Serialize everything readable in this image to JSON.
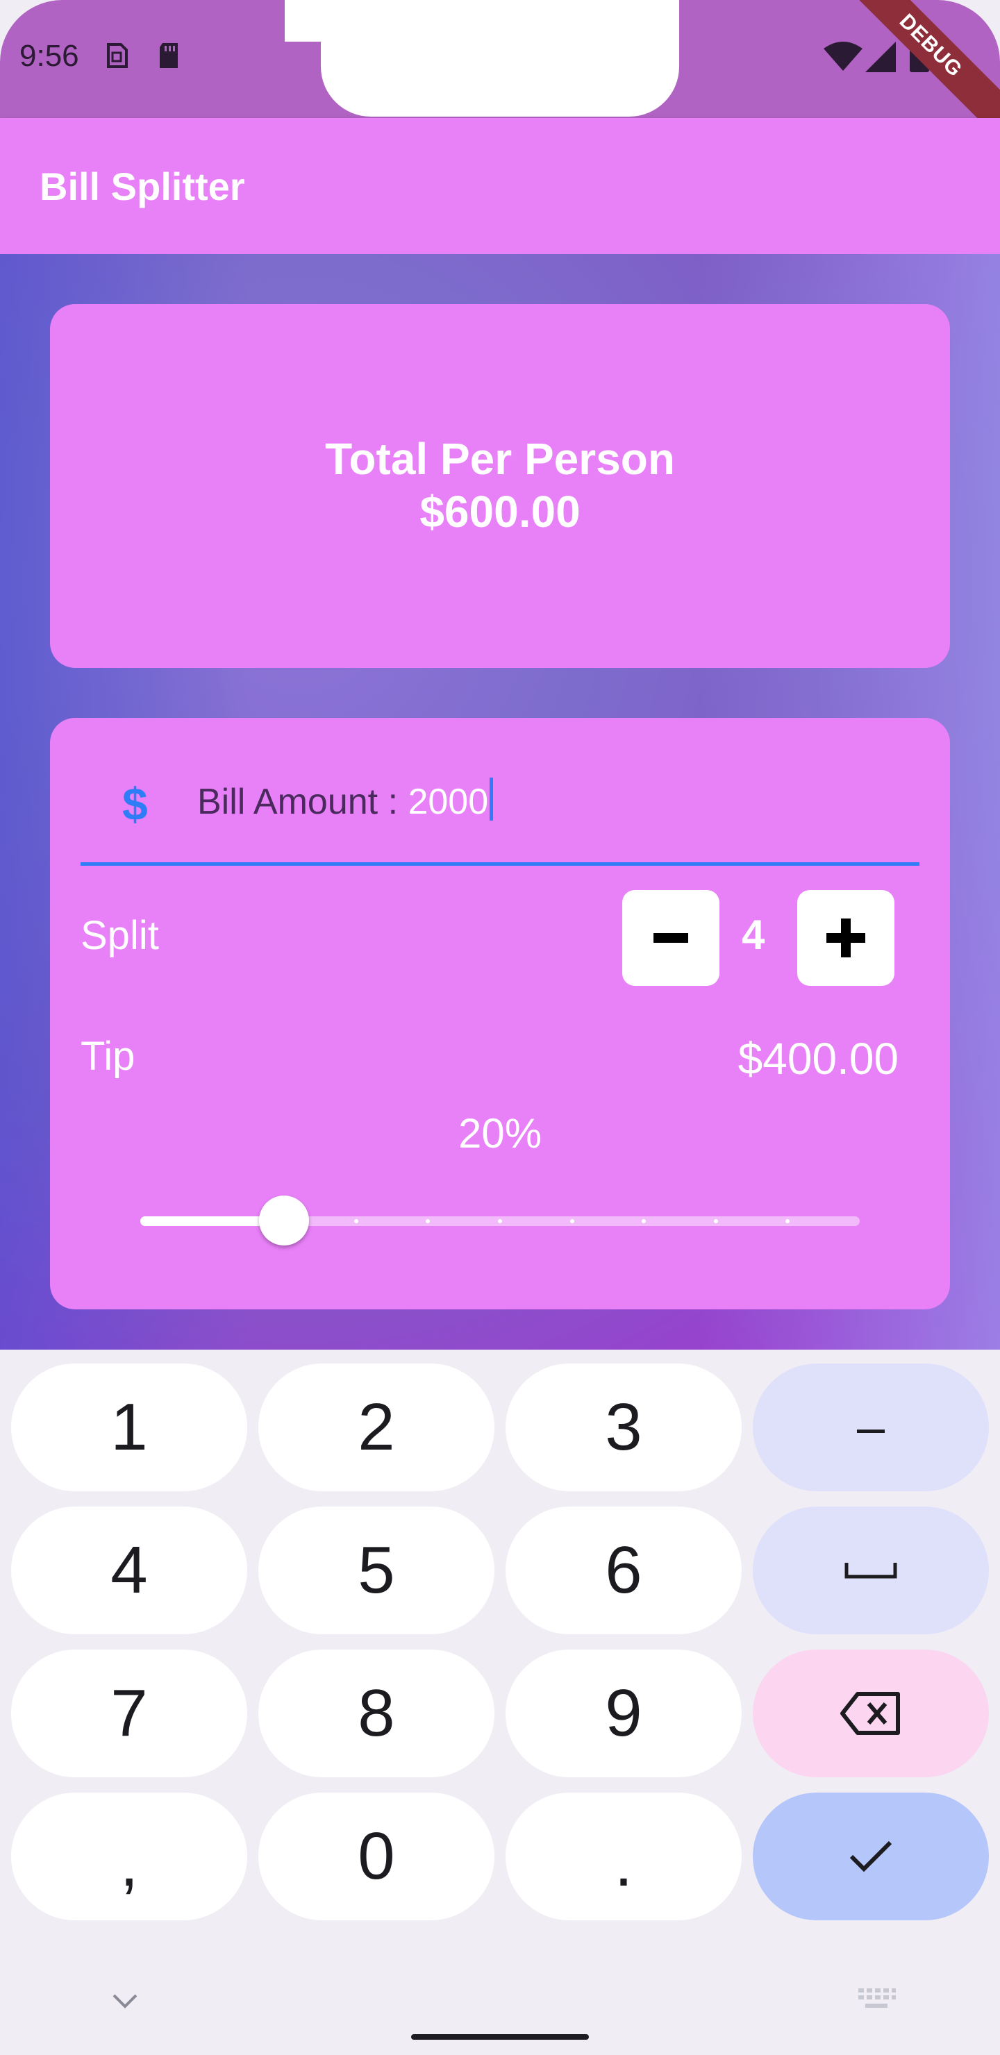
{
  "status_bar": {
    "time": "9:56",
    "icons": [
      "sim-card-icon",
      "sd-card-icon",
      "wifi-icon",
      "signal-icon",
      "battery-icon"
    ],
    "debug_banner": "DEBUG"
  },
  "app_bar": {
    "title": "Bill Splitter"
  },
  "summary_card": {
    "label": "Total Per Person",
    "value": "$600.00"
  },
  "form": {
    "currency_symbol": "$",
    "bill_label": "Bill Amount : ",
    "bill_value": "2000",
    "split_label": "Split",
    "split_value": "4",
    "minus_label": "−",
    "plus_label": "+",
    "tip_label": "Tip",
    "tip_value": "$400.00",
    "tip_percent_label": "20%",
    "tip_slider": {
      "min": 0,
      "max": 100,
      "value": 20,
      "divisions": 10
    }
  },
  "keyboard": {
    "rows": [
      [
        "1",
        "2",
        "3",
        "–"
      ],
      [
        "4",
        "5",
        "6",
        "space"
      ],
      [
        "7",
        "8",
        "9",
        "backspace"
      ],
      [
        ",",
        "0",
        ".",
        "done"
      ]
    ]
  },
  "colors": {
    "app_bar": "#e880f8",
    "card": "#e880f8",
    "accent": "#2e7cf6",
    "status_bar": "#b163c3"
  }
}
